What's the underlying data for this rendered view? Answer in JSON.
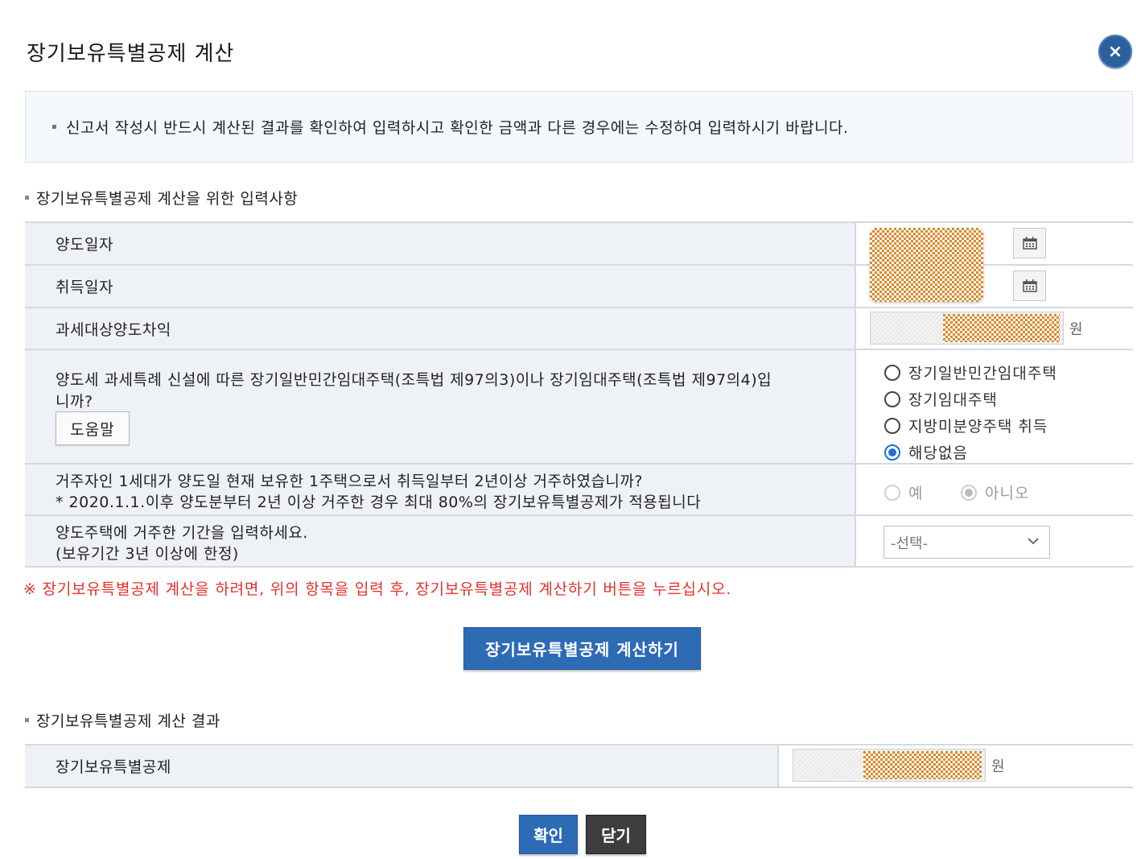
{
  "dialog": {
    "title": "장기보유특별공제 계산",
    "close_icon": "×"
  },
  "notice": {
    "text": "신고서 작성시 반드시 계산된 결과를 확인하여 입력하시고 확인한 금액과 다른 경우에는 수정하여 입력하시기 바랍니다."
  },
  "input_section": {
    "title": "장기보유특별공제 계산을 위한 입력사항",
    "transfer_date_label": "양도일자",
    "acquisition_date_label": "취득일자",
    "taxable_gain_label": "과세대상양도차익",
    "won_unit": "원",
    "rental_question_line1": "양도세 과세특례 신설에 따른 장기일반민간임대주택(조특법 제97의3)이나 장기임대주택(조특법 제97의4)입",
    "rental_question_line2": "니까?",
    "help_button": "도움말",
    "rental_options": [
      {
        "label": "장기일반민간임대주택",
        "checked": false
      },
      {
        "label": "장기임대주택",
        "checked": false
      },
      {
        "label": "지방미분양주택 취득",
        "checked": false
      },
      {
        "label": "해당없음",
        "checked": true
      }
    ],
    "residence_question_line1": "거주자인 1세대가 양도일 현재 보유한 1주택으로서 취득일부터 2년이상 거주하였습니까?",
    "residence_question_line2": "* 2020.1.1.이후 양도분부터 2년 이상 거주한 경우 최대 80%의 장기보유특별공제가 적용됩니다",
    "residence_yes": "예",
    "residence_no": "아니오",
    "residence_selected": "아니오",
    "period_label_line1": "양도주택에 거주한 기간을 입력하세요.",
    "period_label_line2": "(보유기간 3년 이상에 한정)",
    "period_select_value": "-선택-"
  },
  "warning": "※ 장기보유특별공제 계산을 하려면, 위의 항목을 입력 후, 장기보유특별공제 계산하기 버튼을 누르십시오.",
  "calc_button": "장기보유특별공제 계산하기",
  "result_section": {
    "title": "장기보유특별공제 계산 결과",
    "label": "장기보유특별공제",
    "won_unit": "원"
  },
  "buttons": {
    "ok": "확인",
    "close": "닫기"
  },
  "colors": {
    "primary": "#2e6bb5",
    "warning": "#e0322a",
    "label_bg": "#eef2f7"
  }
}
